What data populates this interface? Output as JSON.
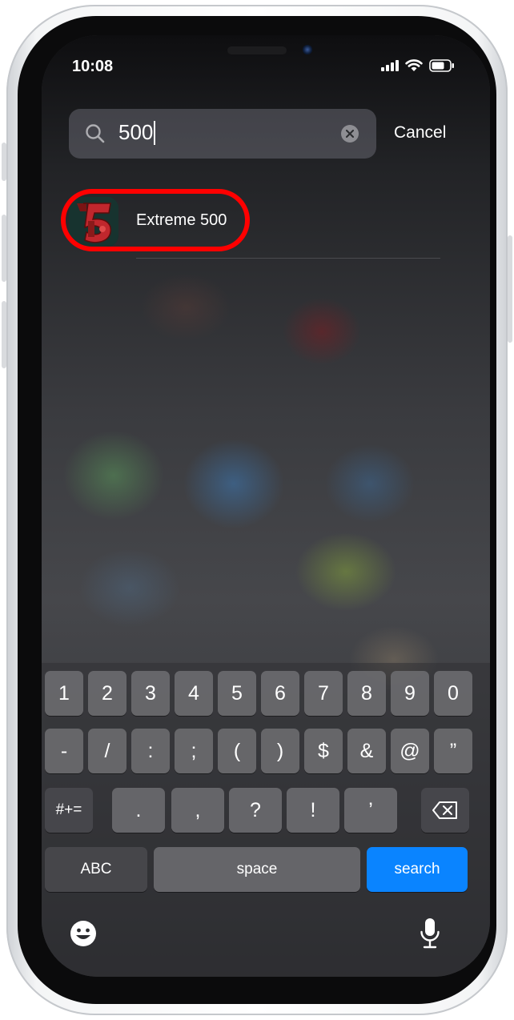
{
  "status_bar": {
    "time": "10:08"
  },
  "search": {
    "query": "500",
    "cancel_label": "Cancel"
  },
  "results": [
    {
      "app_name": "Extreme 500",
      "icon": "extreme-500-app-icon"
    }
  ],
  "keyboard": {
    "row1": [
      "1",
      "2",
      "3",
      "4",
      "5",
      "6",
      "7",
      "8",
      "9",
      "0"
    ],
    "row2": [
      "-",
      "/",
      ":",
      ";",
      "(",
      ")",
      "$",
      "&",
      "@",
      "”"
    ],
    "row3_mode": "#+=",
    "row3": [
      ".",
      ",",
      "?",
      "!",
      "’"
    ],
    "mode_label": "ABC",
    "space_label": "space",
    "return_label": "search"
  },
  "colors": {
    "highlight_ring": "#ff0000",
    "search_key": "#0a84ff"
  },
  "icons": {
    "emoji": "emoji-icon",
    "dictation": "microphone-icon",
    "backspace": "backspace-icon"
  }
}
